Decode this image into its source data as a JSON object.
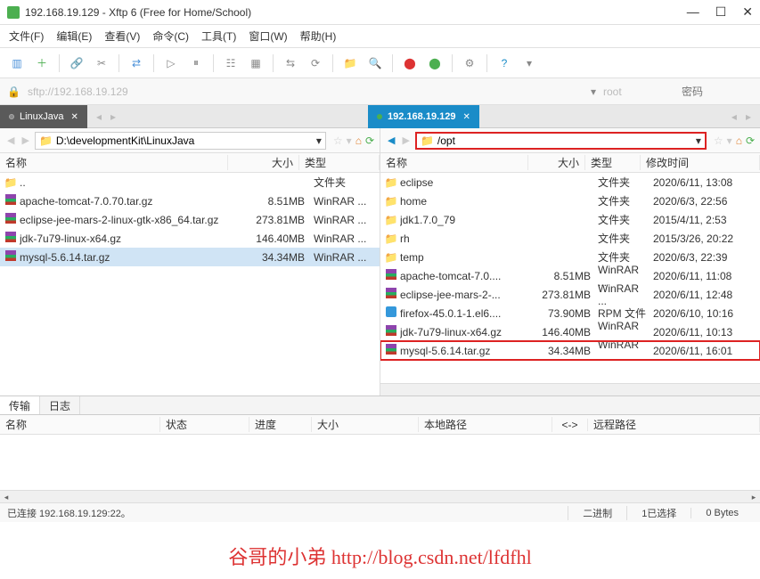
{
  "window": {
    "title": "192.168.19.129 - Xftp 6 (Free for Home/School)"
  },
  "menu": [
    "文件(F)",
    "编辑(E)",
    "查看(V)",
    "命令(C)",
    "工具(T)",
    "窗口(W)",
    "帮助(H)"
  ],
  "address": {
    "sftp": "sftp://192.168.19.129",
    "user": "root",
    "pass_placeholder": "密码"
  },
  "tabs": {
    "local": "LinuxJava",
    "remote": "192.168.19.129"
  },
  "local": {
    "path": "D:\\developmentKit\\LinuxJava",
    "cols": {
      "name": "名称",
      "size": "大小",
      "type": "类型"
    },
    "rows": [
      {
        "icon": "folder",
        "name": "..",
        "size": "",
        "type": "文件夹"
      },
      {
        "icon": "rar",
        "name": "apache-tomcat-7.0.70.tar.gz",
        "size": "8.51MB",
        "type": "WinRAR ..."
      },
      {
        "icon": "rar",
        "name": "eclipse-jee-mars-2-linux-gtk-x86_64.tar.gz",
        "size": "273.81MB",
        "type": "WinRAR ..."
      },
      {
        "icon": "rar",
        "name": "jdk-7u79-linux-x64.gz",
        "size": "146.40MB",
        "type": "WinRAR ..."
      },
      {
        "icon": "rar",
        "name": "mysql-5.6.14.tar.gz",
        "size": "34.34MB",
        "type": "WinRAR ...",
        "sel": true
      }
    ]
  },
  "remote": {
    "path": "/opt",
    "cols": {
      "name": "名称",
      "size": "大小",
      "type": "类型",
      "date": "修改时间"
    },
    "rows": [
      {
        "icon": "folder",
        "name": "eclipse",
        "size": "",
        "type": "文件夹",
        "date": "2020/6/11, 13:08"
      },
      {
        "icon": "folder",
        "name": "home",
        "size": "",
        "type": "文件夹",
        "date": "2020/6/3, 22:56"
      },
      {
        "icon": "folder",
        "name": "jdk1.7.0_79",
        "size": "",
        "type": "文件夹",
        "date": "2015/4/11, 2:53"
      },
      {
        "icon": "folder",
        "name": "rh",
        "size": "",
        "type": "文件夹",
        "date": "2015/3/26, 20:22"
      },
      {
        "icon": "folder",
        "name": "temp",
        "size": "",
        "type": "文件夹",
        "date": "2020/6/3, 22:39"
      },
      {
        "icon": "rar",
        "name": "apache-tomcat-7.0....",
        "size": "8.51MB",
        "type": "WinRAR ...",
        "date": "2020/6/11, 11:08"
      },
      {
        "icon": "rar",
        "name": "eclipse-jee-mars-2-...",
        "size": "273.81MB",
        "type": "WinRAR ...",
        "date": "2020/6/11, 12:48"
      },
      {
        "icon": "rpm",
        "name": "firefox-45.0.1-1.el6....",
        "size": "73.90MB",
        "type": "RPM 文件",
        "date": "2020/6/10, 10:16"
      },
      {
        "icon": "rar",
        "name": "jdk-7u79-linux-x64.gz",
        "size": "146.40MB",
        "type": "WinRAR ...",
        "date": "2020/6/11, 10:13"
      },
      {
        "icon": "rar",
        "name": "mysql-5.6.14.tar.gz",
        "size": "34.34MB",
        "type": "WinRAR ...",
        "date": "2020/6/11, 16:01",
        "hl": true
      }
    ]
  },
  "log": {
    "tabs": [
      "传输",
      "日志"
    ],
    "cols": {
      "name": "名称",
      "status": "状态",
      "progress": "进度",
      "size": "大小",
      "localpath": "本地路径",
      "arrow": "<->",
      "remotepath": "远程路径"
    }
  },
  "status": {
    "conn": "已连接 192.168.19.129:22。",
    "binary": "二进制",
    "selected": "1已选择",
    "bytes": "0 Bytes"
  },
  "watermark": "谷哥的小弟 http://blog.csdn.net/lfdfhl"
}
